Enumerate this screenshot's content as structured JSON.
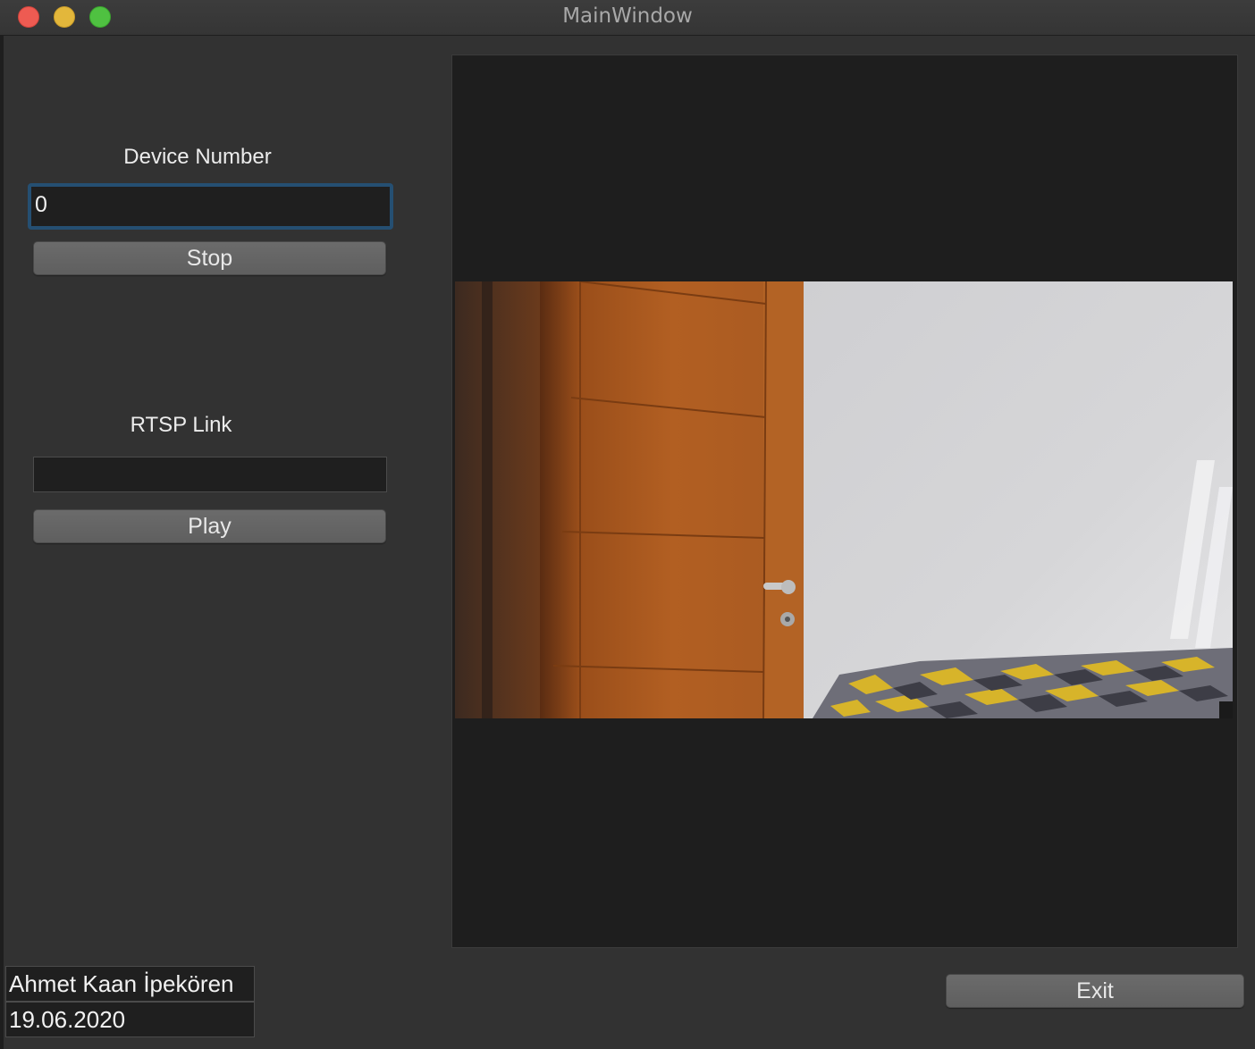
{
  "window": {
    "title": "MainWindow"
  },
  "device": {
    "label": "Device Number",
    "value": "0",
    "button_label": "Stop"
  },
  "rtsp": {
    "label": "RTSP Link",
    "value": "",
    "button_label": "Play"
  },
  "footer": {
    "author": "Ahmet Kaan İpekören",
    "date": "19.06.2020",
    "exit_label": "Exit"
  },
  "colors": {
    "window_bg": "#323232",
    "panel_bg": "#1e1e1e",
    "focus_ring": "#254f72",
    "button_bg": "#666666"
  }
}
